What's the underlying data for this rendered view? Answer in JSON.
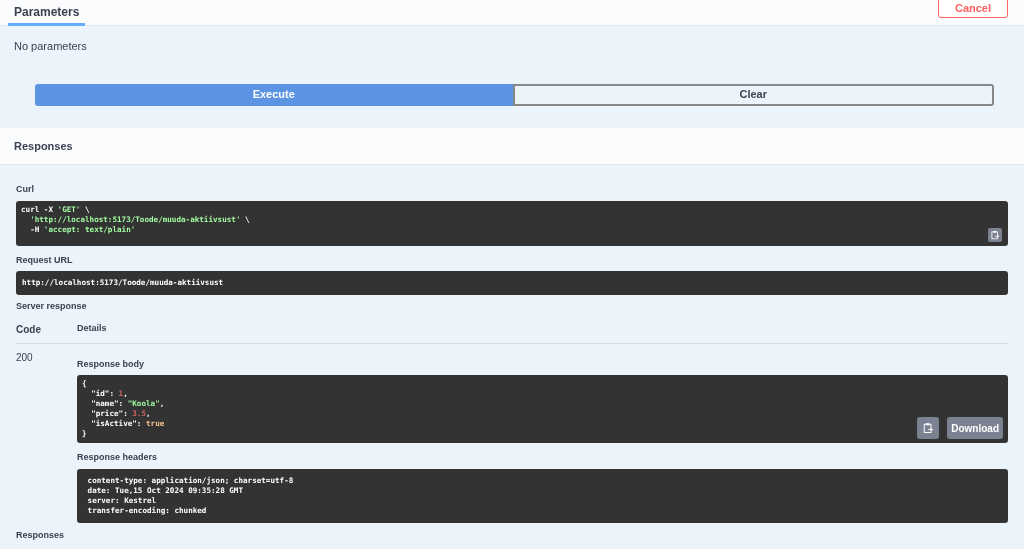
{
  "tabs": [
    {
      "label": "Parameters",
      "selected": true
    }
  ],
  "cancel_button": "Cancel",
  "parameters_note": "No parameters",
  "buttons": [
    {
      "label": "Execute",
      "kind": "primary"
    },
    {
      "label": "Clear",
      "kind": "outline"
    }
  ],
  "responses_heading": "Responses",
  "curl": {
    "label": "Curl",
    "lines": [
      [
        {
          "kind": "plain",
          "text": "curl -X "
        },
        {
          "kind": "string",
          "text": "'GET'"
        },
        {
          "kind": "plain",
          "text": " \\"
        }
      ],
      [
        {
          "kind": "string",
          "text": "  'http://localhost:5173/Toode/muuda-aktiivsust'"
        },
        {
          "kind": "plain",
          "text": " \\"
        }
      ],
      [
        {
          "kind": "plain",
          "text": "  -H "
        },
        {
          "kind": "string",
          "text": "'accept: text/plain'"
        }
      ]
    ]
  },
  "request_url": {
    "label": "Request URL",
    "value": "http://localhost:5173/Toode/muuda-aktiivsust"
  },
  "server_response": {
    "label": "Server response",
    "columns": [
      "Code",
      "Details"
    ],
    "code": "200",
    "body": {
      "label": "Response body",
      "download": "Download",
      "lines": [
        [
          {
            "kind": "plain",
            "text": "{"
          }
        ],
        [
          {
            "kind": "plain",
            "text": "  \"id\": "
          },
          {
            "kind": "number",
            "text": "1"
          },
          {
            "kind": "plain",
            "text": ","
          }
        ],
        [
          {
            "kind": "plain",
            "text": "  \"name\": "
          },
          {
            "kind": "string",
            "text": "\"Koola\""
          },
          {
            "kind": "plain",
            "text": ","
          }
        ],
        [
          {
            "kind": "plain",
            "text": "  \"price\": "
          },
          {
            "kind": "number",
            "text": "3.5"
          },
          {
            "kind": "plain",
            "text": ","
          }
        ],
        [
          {
            "kind": "plain",
            "text": "  \"isActive\": "
          },
          {
            "kind": "bool",
            "text": "true"
          }
        ],
        [
          {
            "kind": "plain",
            "text": "}"
          }
        ]
      ]
    },
    "headers": {
      "label": "Response headers",
      "lines": [
        " content-type: application/json; charset=utf-8 ",
        " date: Tue,15 Oct 2024 09:35:28 GMT ",
        " server: Kestrel ",
        " transfer-encoding: chunked "
      ]
    }
  },
  "footer_heading": "Responses"
}
